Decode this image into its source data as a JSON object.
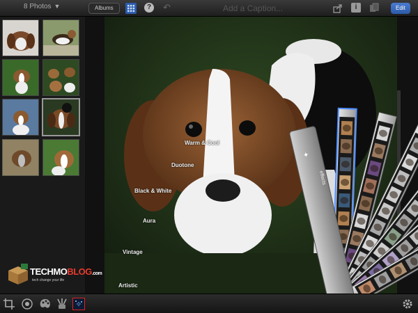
{
  "topbar": {
    "photos_dropdown": "8 Photos",
    "albums_label": "Albums",
    "caption_placeholder": "Add a Caption...",
    "edit_label": "Edit",
    "help_label": "?",
    "info_label": "i"
  },
  "effects": {
    "labels": [
      "Warm & Cool",
      "Duotone",
      "Black & White",
      "Aura",
      "Vintage",
      "Artistic"
    ],
    "fan_header": "effects"
  },
  "watermark": {
    "techmo": "TECHMO",
    "blog": "BLOG",
    "com": ".com",
    "tagline": "tech change your life"
  },
  "colors": {
    "accent": "#2c5cab",
    "active_outline": "#dd2222",
    "logo_red": "#e63a2e"
  },
  "icons": [
    "caret-down-icon",
    "grid-icon",
    "help-icon",
    "undo-icon",
    "share-icon",
    "info-icon",
    "compare-icon",
    "crop-icon",
    "auto-enhance-icon",
    "color-palette-icon",
    "brushes-icon",
    "effects-icon",
    "gear-icon"
  ]
}
